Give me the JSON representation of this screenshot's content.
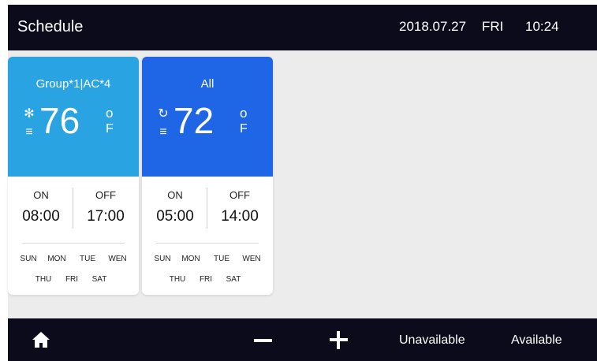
{
  "header": {
    "title": "Schedule",
    "date": "2018.07.27",
    "weekday": "FRI",
    "time": "10:24"
  },
  "cards": [
    {
      "name": "Group*1|AC*4",
      "color": "#2aa3e3",
      "mode_icon": "snowflake-icon",
      "mode_glyph": "✻",
      "fan_icon": "fan-speed-icon",
      "fan_glyph": "≡",
      "temperature": "76",
      "degree_symbol": "o",
      "unit": "F",
      "on_label": "ON",
      "off_label": "OFF",
      "on_time": "08:00",
      "off_time": "17:00",
      "days_row1": [
        "SUN",
        "MON",
        "TUE",
        "WEN"
      ],
      "days_row2": [
        "THU",
        "FRI",
        "SAT"
      ]
    },
    {
      "name": "All",
      "color": "#1f66e6",
      "mode_icon": "auto-mode-icon",
      "mode_glyph": "↻",
      "fan_icon": "fan-speed-icon",
      "fan_glyph": "≡",
      "temperature": "72",
      "degree_symbol": "o",
      "unit": "F",
      "on_label": "ON",
      "off_label": "OFF",
      "on_time": "05:00",
      "off_time": "14:00",
      "days_row1": [
        "SUN",
        "MON",
        "TUE",
        "WEN"
      ],
      "days_row2": [
        "THU",
        "FRI",
        "SAT"
      ]
    }
  ],
  "footer": {
    "home_icon": "home-icon",
    "minus_icon": "minus-icon",
    "plus_icon": "plus-icon",
    "unavailable_label": "Unavailable",
    "available_label": "Available"
  },
  "colors": {
    "bar_background": "#0c0b1c",
    "content_background": "#ececec"
  }
}
